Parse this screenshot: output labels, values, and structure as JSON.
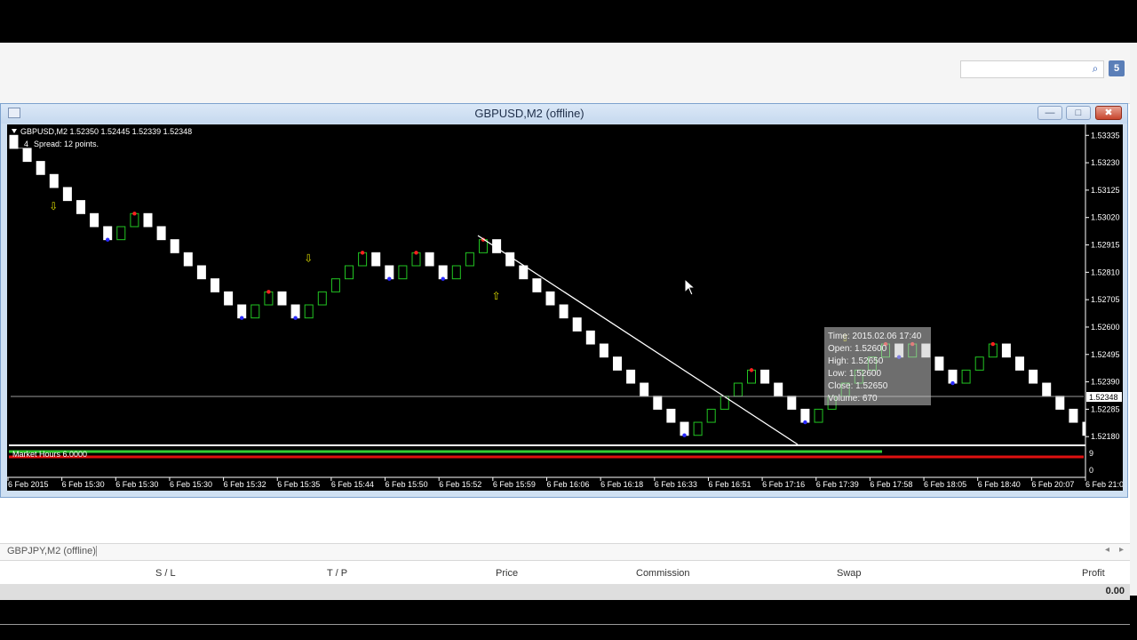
{
  "toolbar": {
    "search_placeholder": "",
    "search_icon": "search-icon",
    "notify_badge": "5"
  },
  "chart_window": {
    "title": "GBPUSD,M2 (offline)",
    "minimize": "—",
    "maximize": "□",
    "close": "✖"
  },
  "chart": {
    "header_line": "GBPUSD,M2  1.52350 1.52445 1.52339 1.52348",
    "spread_line": "Spread: 12 points.",
    "spread_prefix": "0__4",
    "current_price": "1.52348",
    "indicator_label": "Market Hours 6.0000",
    "indicator_max": "9",
    "indicator_min": "0",
    "tooltip": {
      "time": "Time: 2015.02.06 17:40",
      "open": "Open: 1.52600",
      "high": "High: 1.52650",
      "low": "Low:  1.52600",
      "close": "Close: 1.52650",
      "volume": "Volume: 670"
    }
  },
  "chart_data": {
    "type": "renko",
    "price_ticks": [
      "1.53335",
      "1.53230",
      "1.53125",
      "1.53020",
      "1.52915",
      "1.52810",
      "1.52705",
      "1.52600",
      "1.52495",
      "1.52390",
      "1.52285",
      "1.52180"
    ],
    "time_ticks": [
      "6 Feb 2015",
      "6 Feb 15:30",
      "6 Feb 15:30",
      "6 Feb 15:30",
      "6 Feb 15:32",
      "6 Feb 15:35",
      "6 Feb 15:44",
      "6 Feb 15:50",
      "6 Feb 15:52",
      "6 Feb 15:59",
      "6 Feb 16:06",
      "6 Feb 16:18",
      "6 Feb 16:33",
      "6 Feb 16:51",
      "6 Feb 17:16",
      "6 Feb 17:39",
      "6 Feb 17:58",
      "6 Feb 18:05",
      "6 Feb 18:40",
      "6 Feb 20:07",
      "6 Feb 21:07"
    ],
    "brick_size": 0.0005,
    "ylim": [
      1.5215,
      1.5337
    ],
    "moves": [
      -1,
      -1,
      -1,
      -1,
      -1,
      -1,
      -1,
      -1,
      1,
      1,
      -1,
      -1,
      -1,
      -1,
      -1,
      -1,
      -1,
      -1,
      1,
      1,
      -1,
      -1,
      1,
      1,
      1,
      1,
      1,
      -1,
      -1,
      1,
      1,
      -1,
      -1,
      1,
      1,
      1,
      -1,
      -1,
      -1,
      -1,
      -1,
      -1,
      -1,
      -1,
      -1,
      -1,
      -1,
      -1,
      -1,
      -1,
      -1,
      1,
      1,
      1,
      1,
      1,
      -1,
      -1,
      -1,
      -1,
      1,
      1,
      1,
      1,
      1,
      1,
      -1,
      1,
      -1,
      -1,
      -1,
      1,
      1,
      1,
      -1,
      -1,
      -1,
      -1,
      -1,
      -1,
      -1,
      -1,
      -1,
      1,
      -1,
      -1
    ],
    "colors": {
      "up": "#22c522",
      "down": "#ffffff",
      "top_marker": "#ff2020",
      "bottom_marker": "#2a2aff",
      "arrow": "#d8d800",
      "background": "#000000",
      "indicator_green": "#33cc33",
      "indicator_red": "#e01010"
    }
  },
  "terminal": {
    "tab_label": "GBPJPY,M2 (offline)",
    "columns": [
      "S / L",
      "T / P",
      "Price",
      "Commission",
      "Swap",
      "Profit"
    ],
    "total_profit": "0.00"
  }
}
